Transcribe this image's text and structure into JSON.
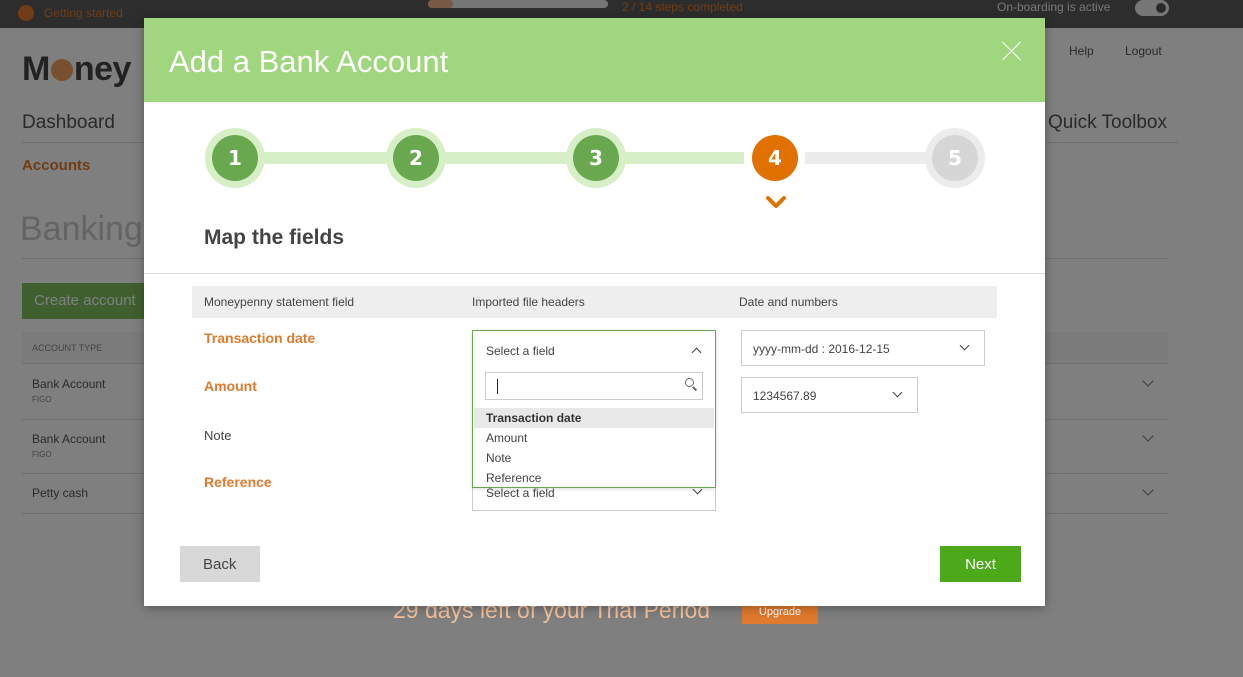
{
  "topbar": {
    "getting_started": "Getting started",
    "steps_completed": "2 / 14 steps completed",
    "progress_fraction": 0.14,
    "onboarding_label": "On-boarding is active",
    "onboarding_active": true
  },
  "background": {
    "logo": {
      "before": "M",
      "after": "ney"
    },
    "nav_dashboard": "Dashboard",
    "nav_accounts": "Accounts",
    "page_title": "Banking",
    "create_button": "Create account",
    "help": "Help",
    "logout": "Logout",
    "quick_toolbox": "Quick Toolbox",
    "table_header": "ACCOUNT TYPE",
    "rows": [
      {
        "name": "Bank Account",
        "sub": "FIGO"
      },
      {
        "name": "Bank Account",
        "sub": "FIGO"
      },
      {
        "name": "Petty cash",
        "sub": ""
      }
    ],
    "trial_text": "29 days left of your Trial Period",
    "upgrade_button": "Upgrade"
  },
  "modal": {
    "title": "Add a Bank Account",
    "steps": [
      {
        "label": "1",
        "state": "done"
      },
      {
        "label": "2",
        "state": "done"
      },
      {
        "label": "3",
        "state": "done"
      },
      {
        "label": "4",
        "state": "active"
      },
      {
        "label": "5",
        "state": "todo"
      }
    ],
    "section_title": "Map the fields",
    "columns": {
      "field": "Moneypenny statement field",
      "headers": "Imported file headers",
      "formats": "Date and numbers"
    },
    "fields": [
      {
        "label": "Transaction date",
        "required": true
      },
      {
        "label": "Amount",
        "required": true
      },
      {
        "label": "Note",
        "required": false
      },
      {
        "label": "Reference",
        "required": true
      }
    ],
    "dropdown": {
      "current": "Select a field",
      "search_value": "",
      "options": [
        "Transaction date",
        "Amount",
        "Note",
        "Reference"
      ],
      "highlighted": "Transaction date"
    },
    "reference_select": "Select a field",
    "date_format": "yyyy-mm-dd : 2016-12-15",
    "number_format": "1234567.89",
    "back_button": "Back",
    "next_button": "Next"
  },
  "colors": {
    "header_green": "#a0d67d",
    "step_done": "#6aa84f",
    "step_active": "#e07000",
    "accent_orange": "#e07a2d",
    "next_green": "#4caa1a"
  }
}
